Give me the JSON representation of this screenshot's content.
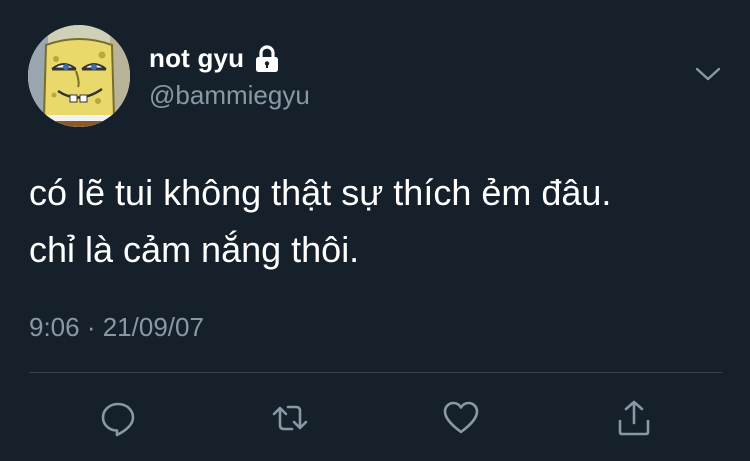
{
  "author": {
    "display_name": "not gyu",
    "handle": "@bammiegyu",
    "avatar_icon": "spongebob-avatar",
    "protected_icon": "lock-icon"
  },
  "tweet": {
    "lines": [
      "có lẽ tui không thật sự thích ẻm đâu.",
      "chỉ là cảm nắng thôi."
    ],
    "timestamp": "9:06 · 21/09/07"
  },
  "actions": [
    {
      "name": "reply",
      "icon": "reply-icon"
    },
    {
      "name": "retweet",
      "icon": "retweet-icon"
    },
    {
      "name": "like",
      "icon": "heart-icon"
    },
    {
      "name": "share",
      "icon": "share-icon"
    }
  ],
  "colors": {
    "background": "#15202b",
    "primary_text": "#ffffff",
    "secondary_text": "#8899a6",
    "divider": "#38444d"
  }
}
